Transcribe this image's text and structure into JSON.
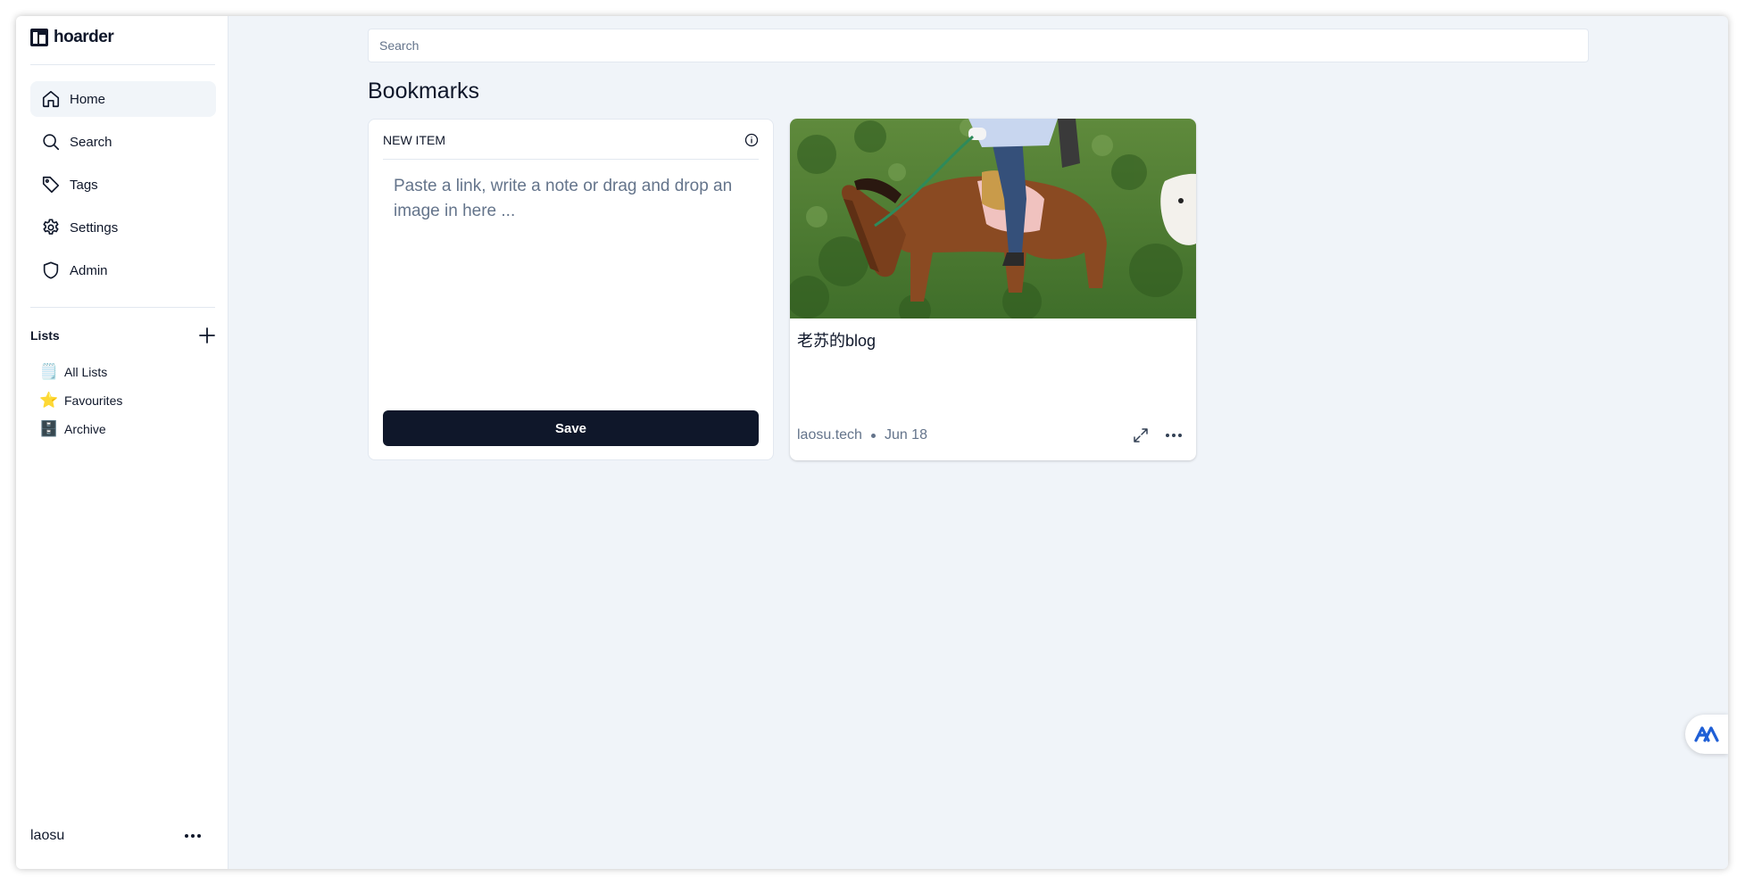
{
  "app": {
    "name": "hoarder"
  },
  "sidebar": {
    "nav": [
      {
        "label": "Home",
        "icon": "home-icon",
        "active": true
      },
      {
        "label": "Search",
        "icon": "search-icon"
      },
      {
        "label": "Tags",
        "icon": "tag-icon"
      },
      {
        "label": "Settings",
        "icon": "gear-icon"
      },
      {
        "label": "Admin",
        "icon": "shield-icon"
      }
    ],
    "lists_title": "Lists",
    "lists": [
      {
        "label": "All Lists",
        "emoji": "🗒️"
      },
      {
        "label": "Favourites",
        "emoji": "⭐"
      },
      {
        "label": "Archive",
        "emoji": "🗄️"
      }
    ],
    "user": {
      "name": "laosu"
    }
  },
  "main": {
    "search": {
      "placeholder": "Search",
      "value": ""
    },
    "title": "Bookmarks",
    "new_item": {
      "header": "NEW ITEM",
      "placeholder": "Paste a link, write a note or drag and drop an image in here ...",
      "save_label": "Save"
    },
    "bookmarks": [
      {
        "title": "老苏的blog",
        "domain": "laosu.tech",
        "date": "Jun 18",
        "image": "horse-riding-photo"
      }
    ]
  },
  "colors": {
    "background": "#f0f4f9",
    "sidebar": "#ffffff",
    "primary_button": "#0f172a",
    "muted_text": "#64748b",
    "floating_accent": "#1f5fd6"
  }
}
